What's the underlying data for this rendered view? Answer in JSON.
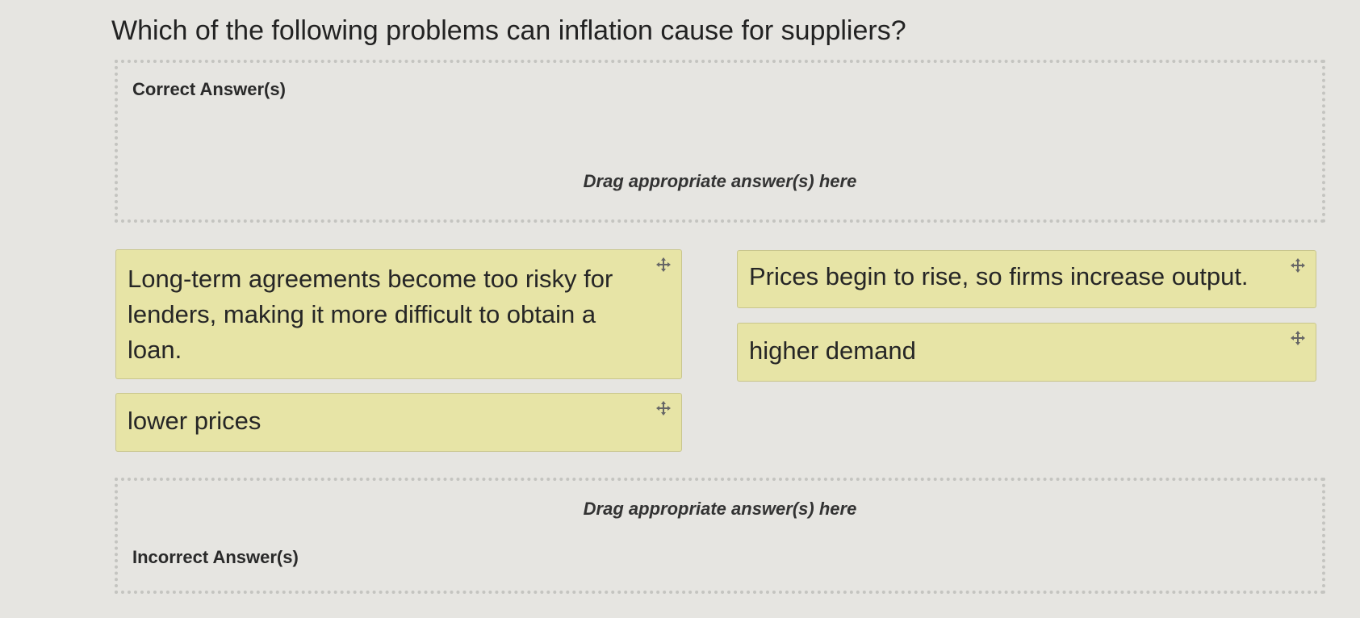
{
  "question": "Which of the following problems can inflation cause for suppliers?",
  "correct_zone": {
    "title": "Correct Answer(s)",
    "hint": "Drag appropriate answer(s) here"
  },
  "incorrect_zone": {
    "title": "Incorrect Answer(s)",
    "hint": "Drag appropriate answer(s) here"
  },
  "answers": [
    {
      "text": "Long-term agreements become too risky for lenders, making it more difficult to obtain a loan.",
      "icon": "move-icon"
    },
    {
      "text": "Prices begin to rise, so firms increase output.",
      "icon": "move-icon"
    },
    {
      "text": "higher demand",
      "icon": "move-icon"
    },
    {
      "text": "lower prices",
      "icon": "move-icon"
    }
  ],
  "colors": {
    "background": "#e6e5e1",
    "card_fill": "#e7e4a6",
    "card_border": "#c9c68d",
    "dropzone_border": "#c4c4c0"
  }
}
